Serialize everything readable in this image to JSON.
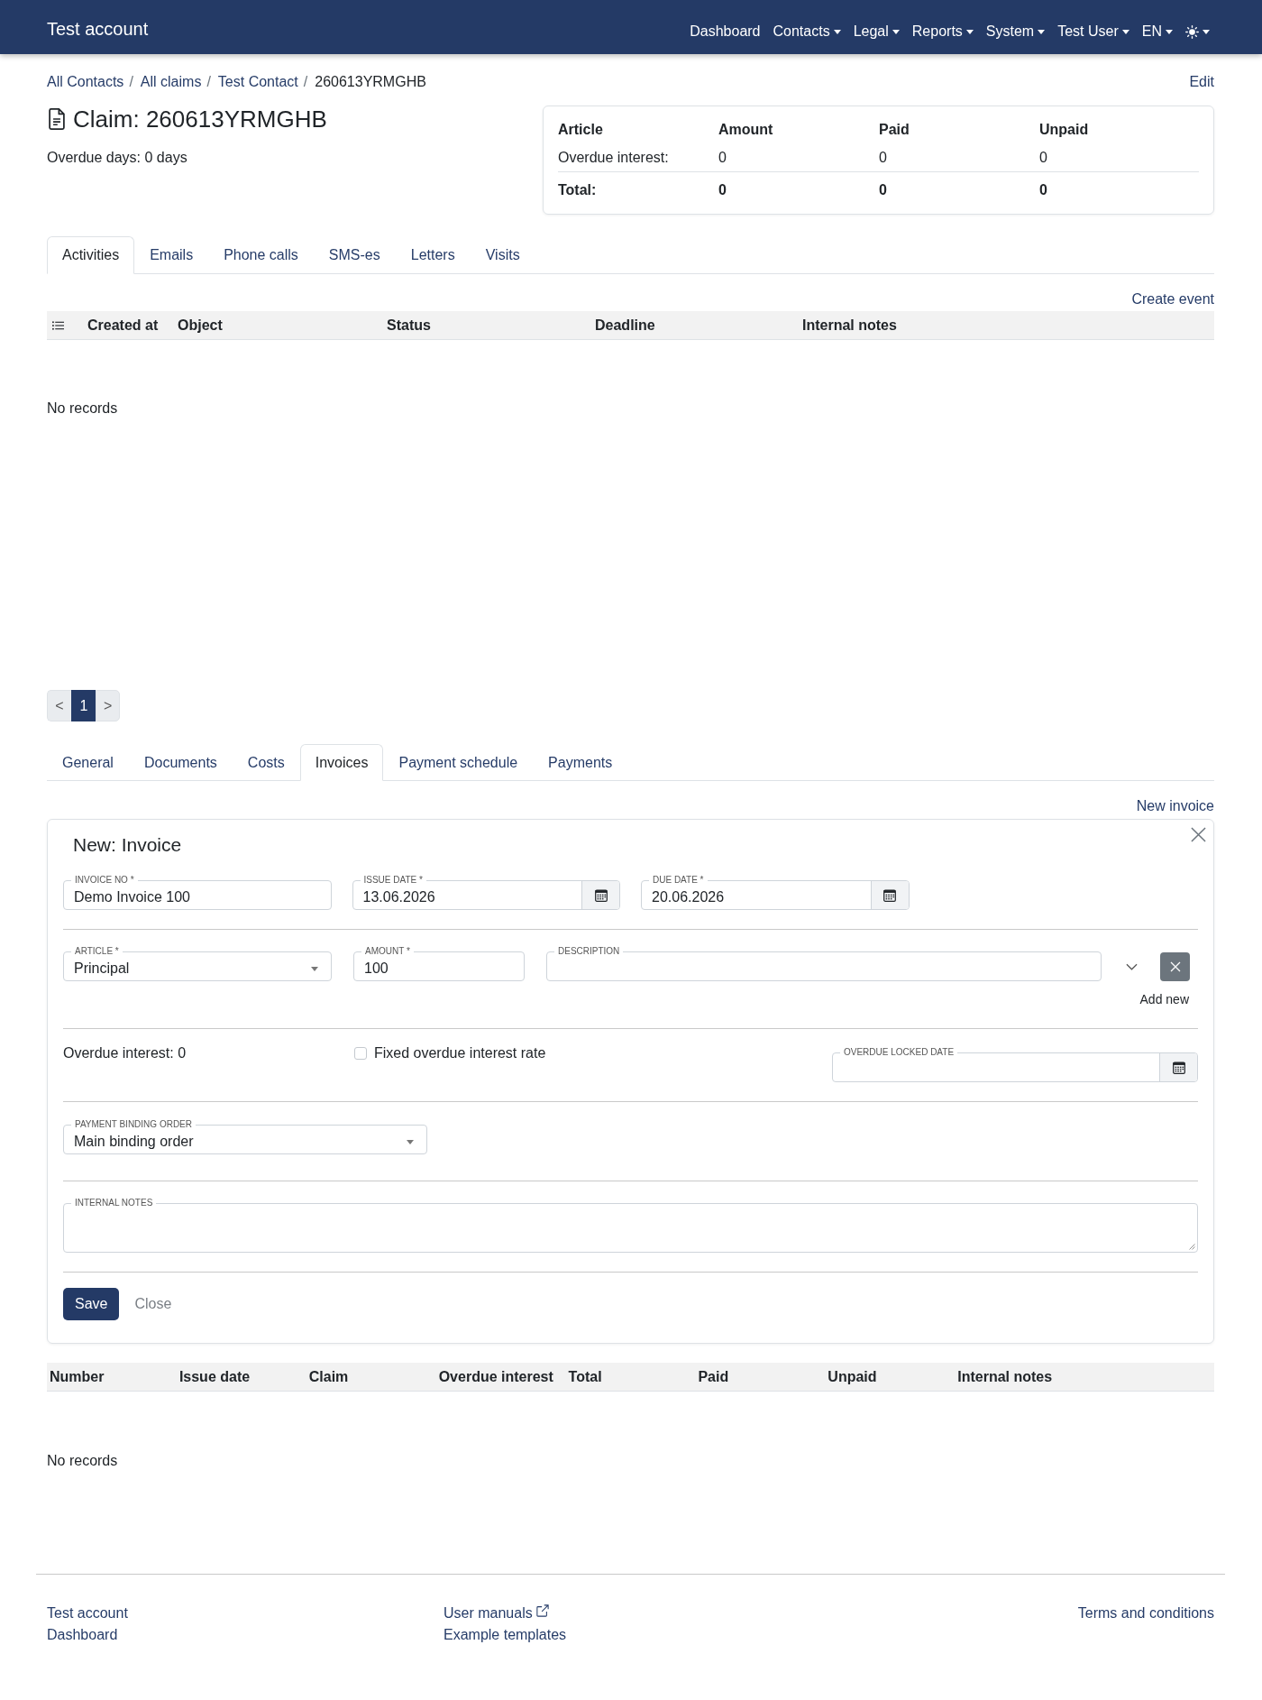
{
  "navbar": {
    "brand": "Test account",
    "items": [
      {
        "label": "Dashboard",
        "dropdown": false
      },
      {
        "label": "Contacts",
        "dropdown": true
      },
      {
        "label": "Legal",
        "dropdown": true
      },
      {
        "label": "Reports",
        "dropdown": true
      },
      {
        "label": "System",
        "dropdown": true
      },
      {
        "label": "Test User",
        "dropdown": true
      },
      {
        "label": "EN",
        "dropdown": true
      }
    ]
  },
  "breadcrumb": {
    "separator": "/",
    "items": [
      {
        "label": "All Contacts",
        "current": false
      },
      {
        "label": "All claims",
        "current": false
      },
      {
        "label": "Test Contact",
        "current": false
      },
      {
        "label": "260613YRMGHB",
        "current": true
      }
    ],
    "action": "Edit"
  },
  "claim": {
    "title": "Claim: 260613YRMGHB",
    "overdue_days": "Overdue days: 0 days"
  },
  "summary": {
    "columns": [
      "Article",
      "Amount",
      "Paid",
      "Unpaid"
    ],
    "rows": [
      {
        "kind": "value",
        "cells": [
          "Overdue interest:",
          "0",
          "0",
          "0"
        ]
      },
      {
        "kind": "total",
        "cells": [
          "Total:",
          "0",
          "0",
          "0"
        ]
      }
    ]
  },
  "activity_tabs": [
    {
      "label": "Activities",
      "selected": true
    },
    {
      "label": "Emails",
      "selected": false
    },
    {
      "label": "Phone calls",
      "selected": false
    },
    {
      "label": "SMS-es",
      "selected": false
    },
    {
      "label": "Letters",
      "selected": false
    },
    {
      "label": "Visits",
      "selected": false
    }
  ],
  "activities": {
    "action": "Create event",
    "columns": [
      "Created at",
      "Object",
      "Status",
      "Deadline",
      "Internal notes"
    ],
    "empty": "No records"
  },
  "pagination": {
    "previous": "<",
    "pages": [
      {
        "label": "1",
        "selected": true
      }
    ],
    "next": ">"
  },
  "claim_tabs": [
    {
      "label": "General",
      "selected": false
    },
    {
      "label": "Documents",
      "selected": false
    },
    {
      "label": "Costs",
      "selected": false
    },
    {
      "label": "Invoices",
      "selected": true
    },
    {
      "label": "Payment schedule",
      "selected": false
    },
    {
      "label": "Payments",
      "selected": false
    }
  ],
  "invoices": {
    "action": "New invoice",
    "form": {
      "title": "New: Invoice",
      "header_fields": [
        {
          "kind": "text",
          "label": "INVOICE NO *",
          "value": "Demo Invoice 100"
        },
        {
          "kind": "date",
          "label": "ISSUE DATE *",
          "value": "13.06.2026"
        },
        {
          "kind": "date",
          "label": "DUE DATE *",
          "value": "20.06.2026"
        }
      ],
      "line": {
        "article": {
          "label": "ARTICLE *",
          "value": "Principal"
        },
        "amount": {
          "label": "AMOUNT *",
          "value": "100"
        },
        "description": {
          "label": "DESCRIPTION"
        },
        "add_new": "Add new"
      },
      "overdue_interest": "Overdue interest: 0",
      "fixed_rate": {
        "label": "Fixed overdue interest rate",
        "checked": false
      },
      "overdue_locked_date": {
        "label": "OVERDUE LOCKED DATE"
      },
      "payment_binding_order": {
        "label": "PAYMENT BINDING ORDER",
        "value": "Main binding order"
      },
      "internal_notes": {
        "label": "INTERNAL NOTES"
      },
      "save": "Save",
      "close": "Close"
    },
    "columns": [
      "Number",
      "Issue date",
      "Claim",
      "Overdue interest",
      "Total",
      "Paid",
      "Unpaid",
      "Internal notes"
    ],
    "empty": "No records"
  },
  "footer": {
    "columns": [
      [
        {
          "label": "Test account",
          "external": false
        },
        {
          "label": "Dashboard",
          "external": false
        }
      ],
      [
        {
          "label": "User manuals",
          "external": true
        },
        {
          "label": "Example templates",
          "external": false
        }
      ],
      [
        {
          "label": "Terms and conditions",
          "external": false
        }
      ]
    ]
  }
}
